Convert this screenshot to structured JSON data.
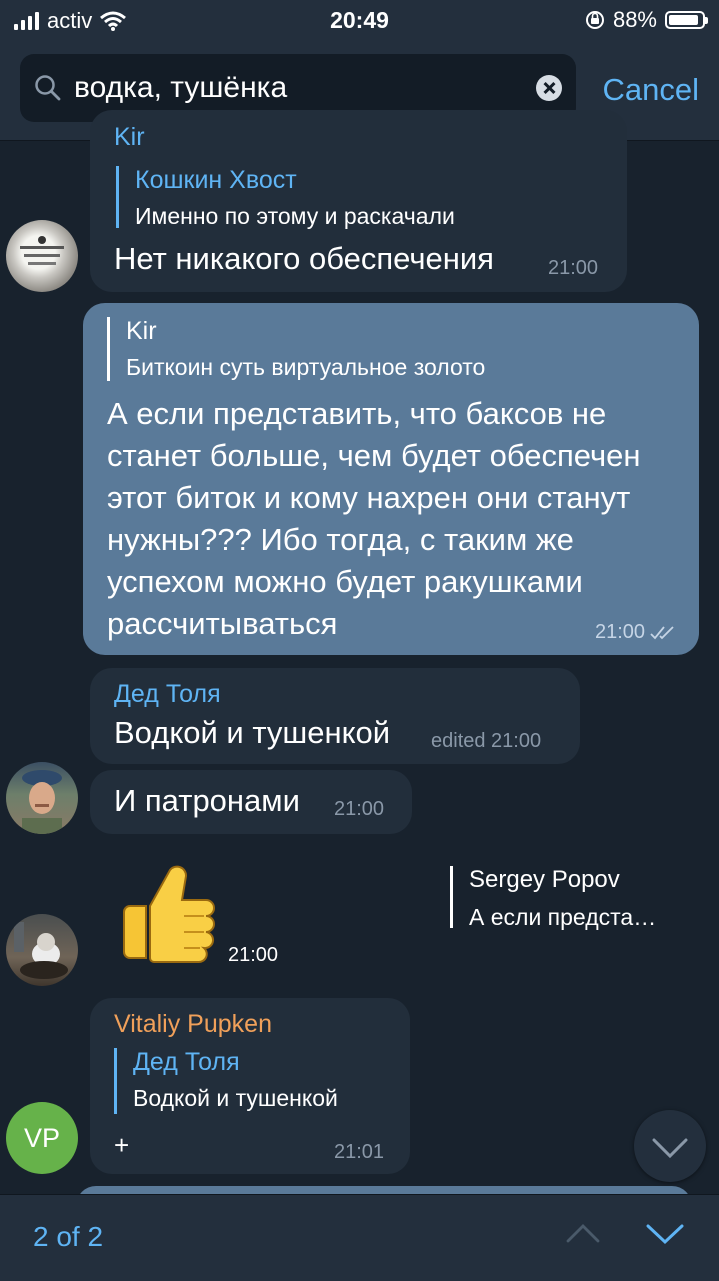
{
  "status_bar": {
    "carrier": "activ",
    "time": "20:49",
    "battery": "88%"
  },
  "search": {
    "query": "водка, тушёнка",
    "cancel_label": "Cancel"
  },
  "messages": [
    {
      "sender": "Kir",
      "reply_name": "Кошкин Хвост",
      "reply_text": "Именно по этому и раскачали",
      "text": "Нет никакого обеспечения",
      "time": "21:00"
    },
    {
      "reply_name": "Kir",
      "reply_text": "Биткоин суть виртуальное золото",
      "lines": [
        "А если представить, что баксов не",
        "станет больше, чем будет обеспечен",
        "этот биток и кому нахрен они станут",
        "нужны??? Ибо тогда, с таким же",
        "успехом можно будет ракушками",
        "рассчитываться"
      ],
      "time": "21:00"
    },
    {
      "sender": "Дед Толя",
      "text": "Водкой и тушенкой",
      "time": "edited 21:00"
    },
    {
      "text": "И патронами",
      "time": "21:00"
    },
    {
      "sticker": "thumbs-up",
      "reply_name": "Sergey Popov",
      "reply_text": "А если предста…",
      "time": "21:00"
    },
    {
      "sender": "Vitaliy Pupken",
      "reply_name": "Дед Толя",
      "reply_text": "Водкой и тушенкой",
      "text": "+",
      "time": "21:01",
      "avatar_initials": "VP"
    }
  ],
  "bottom": {
    "counter": "2 of 2"
  },
  "colors": {
    "accent": "#5fb4f4",
    "background": "#18222d",
    "incoming": "#222e3b",
    "outgoing": "#5a7a99",
    "vp_avatar": "#66b24a",
    "vitaliy_name": "#f0a05a"
  }
}
